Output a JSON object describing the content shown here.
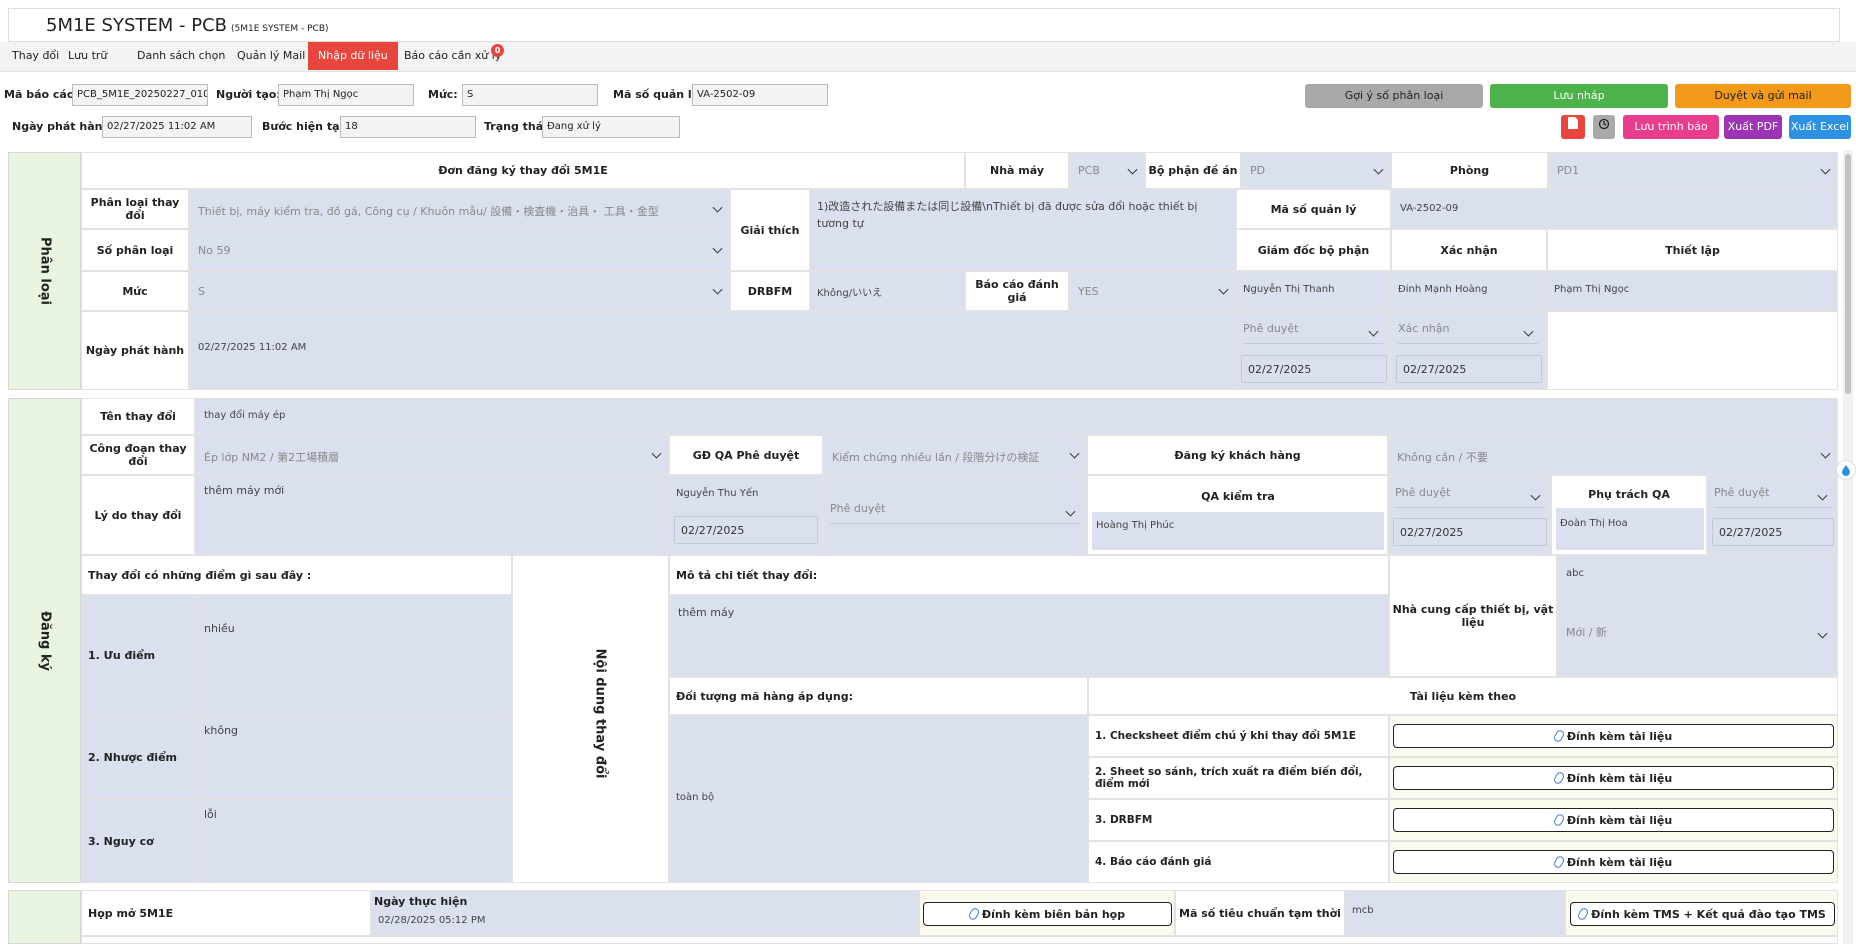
{
  "app": {
    "title": "5M1E SYSTEM - PCB",
    "subtitle": "(5M1E SYSTEM - PCB)"
  },
  "tabs": [
    {
      "label": "Thay đổi"
    },
    {
      "label": "Lưu trữ"
    },
    {
      "label": "Danh sách chọn"
    },
    {
      "label": "Quản lý Mail"
    },
    {
      "label": "Nhập dữ liệu"
    },
    {
      "label": "Báo cáo cần xử lý"
    }
  ],
  "tab_badge": "0",
  "header": {
    "ma_bao_cao_label": "Mã báo cáo:",
    "ma_bao_cao": "PCB_5M1E_20250227_010",
    "nguoi_tao_label": "Người tạo:",
    "nguoi_tao": "Phạm Thị Ngọc",
    "muc_label": "Mức:",
    "muc": "S",
    "ma_so_ql_label": "Mã số quản lý:",
    "ma_so_ql": "VA-2502-09",
    "ngay_ph_label": "Ngày phát hành:",
    "ngay_ph": "02/27/2025 11:02 AM",
    "buoc_label": "Bước hiện tại:",
    "buoc": "18",
    "trang_thai_label": "Trạng thái:",
    "trang_thai": "Đang xử lý"
  },
  "actions": {
    "goi_y": "Gợi ý số phân loại",
    "luu_nhap": "Lưu nháp",
    "duyet": "Duyệt và gửi mail",
    "luu_trinh": "Lưu trình báo cáo",
    "xuat_pdf": "Xuất PDF",
    "xuat_excel": "Xuất Excel"
  },
  "colors": {
    "red": "#e8453c",
    "green": "#4db24a",
    "orange": "#f39a1a",
    "gray": "#a9a9a9",
    "pink": "#e83d8c",
    "purple": "#9b35b4",
    "blue": "#2e90e0",
    "cell_blue": "#dbe0ef"
  },
  "phan_loai": {
    "side": "Phân loại",
    "don_dk": "Đơn đăng ký thay đổi 5M1E",
    "nha_may_label": "Nhà máy",
    "nha_may": "PCB",
    "bo_phan_label": "Bộ phận đề án",
    "bo_phan": "PD",
    "phong_label": "Phòng",
    "phong": "PD1",
    "phan_loai_td_label": "Phân loại thay đổi",
    "phan_loai_td": "Thiết bị, máy kiểm tra, đồ gá, Công cụ / Khuôn mẫu/ 設備・検査機・治具・ 工具・金型",
    "giai_thich_label": "Giải thích",
    "giai_thich": "1)改造された設備または同じ設備\\nThiết bị đã được sửa đổi hoặc thiết bị tương tự",
    "ma_so_ql_label": "Mã số quản lý",
    "ma_so_ql": "VA-2502-09",
    "so_pl_label": "Số phân loại",
    "so_pl": "No 59",
    "gd_bp_label": "Giám đốc bộ phận",
    "xac_nhan_label": "Xác nhận",
    "thiet_lap_label": "Thiết lập",
    "muc_label": "Mức",
    "muc": "S",
    "drbfm_label": "DRBFM",
    "drbfm": "Không/いいえ",
    "bcdg_label": "Báo cáo đánh giá",
    "bcdg": "YES",
    "gd_bp_name": "Nguyễn Thị Thanh",
    "xac_nhan_name": "Đinh Mạnh Hoàng",
    "thiet_lap_name": "Phạm Thị Ngọc",
    "ngay_ph_label": "Ngày phát hành",
    "ngay_ph": "02/27/2025 11:02 AM",
    "phe_duyet": "Phê duyệt",
    "xac_nhan_sel": "Xác nhận",
    "date1": "02/27/2025",
    "date2": "02/27/2025"
  },
  "dang_ky": {
    "side": "Đăng ký",
    "ten_td_label": "Tên thay đổi",
    "ten_td": "thay đổi máy ép",
    "cong_doan_label": "Công đoạn thay đổi",
    "cong_doan": "Ép lớp NM2 / 第2工場積層",
    "gd_qa_label": "GĐ QA Phê duyệt",
    "gd_qa": "Kiểm chứng nhiều lần / 段階分けの検証",
    "dk_kh_label": "Đăng ký khách hàng",
    "dk_kh": "Không cần / 不要",
    "ly_do_label": "Lý do thay đổi",
    "ly_do": "thêm máy mới",
    "gd_qa_name": "Nguyễn Thu Yến",
    "gd_qa_date": "02/27/2025",
    "gd_qa_sel": "Phê duyệt",
    "qa_kt_label": "QA kiểm tra",
    "qa_kt_name": "Hoàng Thị Phúc",
    "qa_kt_sel": "Phê duyệt",
    "qa_kt_date": "02/27/2025",
    "phu_trach_label": "Phụ trách QA",
    "phu_trach_sel": "Phê duyệt",
    "phu_trach_name": "Đoàn Thị Hoa",
    "phu_trach_date": "02/27/2025",
    "diem_label": "Thay đổi có những điểm gì sau đây :",
    "uu_label": "1. Ưu điểm",
    "uu": "nhiều",
    "nhuoc_label": "2. Nhược điểm",
    "nhuoc": "không",
    "nguy_label": "3. Nguy cơ",
    "nguy": "lỗi",
    "noi_dung": "Nội dung thay đổi",
    "mo_ta_label": "Mô tả chi tiết thay đổi:",
    "mo_ta": "thêm máy",
    "ncc_label": "Nhà cung cấp thiết bị, vật liệu",
    "ncc": "abc",
    "ncc_sel": "Mới / 新",
    "doi_tuong_label": "Đối tượng mã hàng áp dụng:",
    "doi_tuong": "toàn bộ",
    "tai_lieu_label": "Tài liệu kèm theo",
    "docs": [
      "1. Checksheet điểm chú ý khi thay đổi 5M1E",
      "2. Sheet so sánh, trích xuất ra điểm biến đổi, điểm mới",
      "3. DRBFM",
      "4. Báo cáo đánh giá"
    ],
    "dinh_kem": "Đính kèm tài liệu"
  },
  "hop": {
    "hop_label": "Họp mở 5M1E",
    "ngay_th_label": "Ngày thực hiện",
    "ngay_th": "02/28/2025 05:12 PM",
    "bien_ban": "Đính kèm biên bản họp",
    "ma_so_tc_label": "Mã số tiêu chuẩn tạm thời",
    "ma_so_tc": "mcb",
    "tms": "Đính kèm TMS + Kết quả đào tạo TMS"
  }
}
